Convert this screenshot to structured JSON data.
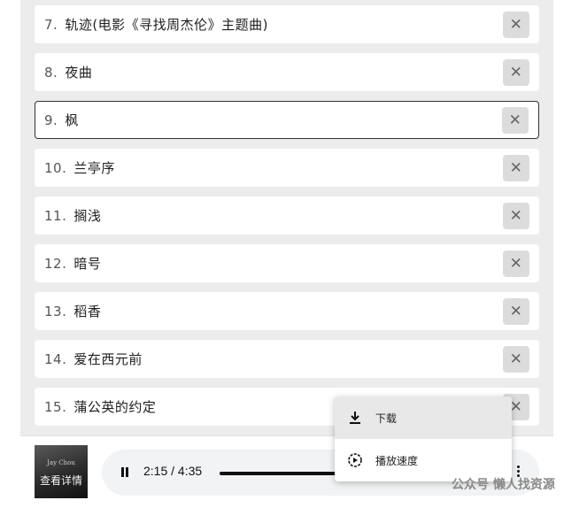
{
  "playlist": {
    "tracks": [
      {
        "num": "7.",
        "title": "轨迹(电影《寻找周杰伦》主题曲)",
        "delete_icon": "✕"
      },
      {
        "num": "8.",
        "title": "夜曲",
        "delete_icon": "✕"
      },
      {
        "num": "9.",
        "title": "枫",
        "delete_icon": "✕"
      },
      {
        "num": "10.",
        "title": "兰亭序",
        "delete_icon": "✕"
      },
      {
        "num": "11.",
        "title": "搁浅",
        "delete_icon": "✕"
      },
      {
        "num": "12.",
        "title": "暗号",
        "delete_icon": "✕"
      },
      {
        "num": "13.",
        "title": "稻香",
        "delete_icon": "✕"
      },
      {
        "num": "14.",
        "title": "爱在西元前",
        "delete_icon": "✕"
      },
      {
        "num": "15.",
        "title": "蒲公英的约定",
        "delete_icon": "✕"
      }
    ]
  },
  "player": {
    "cover_label": "查看详情",
    "cover_subtext": "Jay Chou",
    "time": "2:15 / 4:35",
    "progress_fraction": 0.49,
    "state": "playing"
  },
  "menu": {
    "download": "下载",
    "speed": "播放速度"
  },
  "watermark": "公众号 懒人找资源",
  "colors": {
    "panel_bg": "#ececec",
    "active_border": "#333333",
    "delete_bg": "#dcdcdc"
  }
}
